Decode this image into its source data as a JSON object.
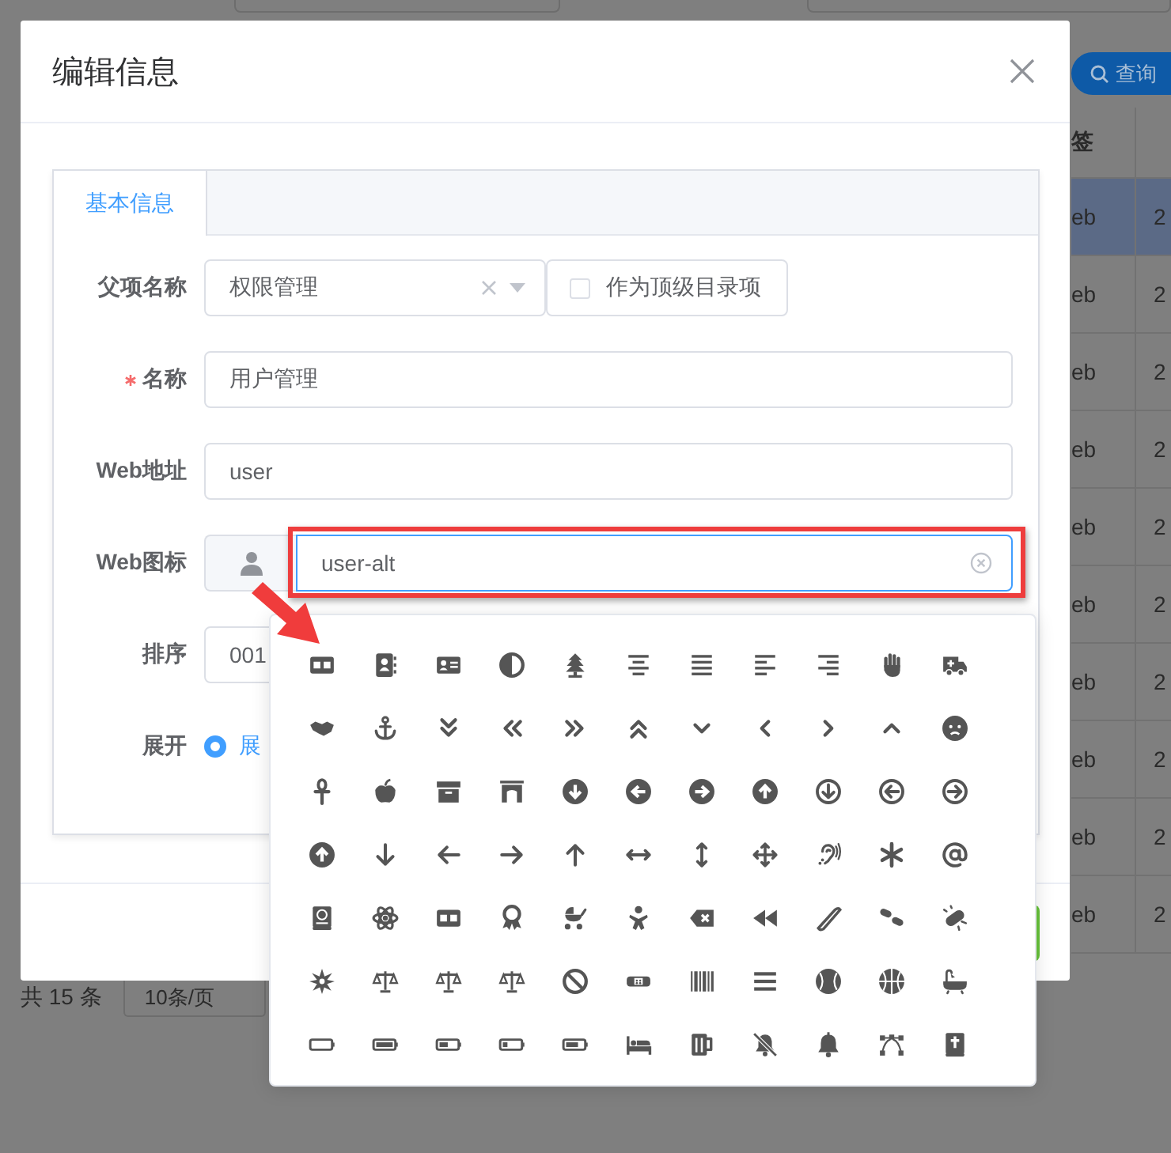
{
  "background": {
    "search_button": {
      "label": "查询"
    },
    "table": {
      "columns": [
        {
          "label": "签"
        }
      ],
      "rows": [
        {
          "cells": [
            "eb",
            "2"
          ],
          "selected": true
        },
        {
          "cells": [
            "eb",
            "2"
          ],
          "selected": false
        },
        {
          "cells": [
            "eb",
            "2"
          ],
          "selected": false
        },
        {
          "cells": [
            "eb",
            "2"
          ],
          "selected": false
        },
        {
          "cells": [
            "eb",
            "2"
          ],
          "selected": false
        },
        {
          "cells": [
            "eb",
            "2"
          ],
          "selected": false
        },
        {
          "cells": [
            "eb",
            "2"
          ],
          "selected": false
        },
        {
          "cells": [
            "eb",
            "2"
          ],
          "selected": false
        },
        {
          "cells": [
            "eb",
            "2"
          ],
          "selected": false
        },
        {
          "cells": [
            "eb",
            "2"
          ],
          "selected": false
        }
      ]
    },
    "pagination": {
      "total": "共 15 条",
      "page_size": "10条/页"
    }
  },
  "dialog": {
    "title": "编辑信息",
    "tabs": [
      {
        "label": "基本信息",
        "selected": true
      }
    ],
    "fields": [
      {
        "kind": "select",
        "label": "父项名称",
        "required": false,
        "value": "权限管理",
        "checkbox": {
          "label": "作为顶级目录项",
          "checked": false
        }
      },
      {
        "kind": "input",
        "label": "名称",
        "required": true,
        "value": "用户管理",
        "focused": false
      },
      {
        "kind": "input",
        "label": "Web地址",
        "required": false,
        "value": "user",
        "focused": false
      },
      {
        "kind": "icon_input",
        "label": "Web图标",
        "required": false,
        "value": "user-alt",
        "focused": true
      },
      {
        "kind": "input",
        "label": "排序",
        "required": false,
        "value": "001",
        "focused": false
      },
      {
        "kind": "radio",
        "label": "展开",
        "required": false,
        "options": [
          {
            "label": "展",
            "selected": true
          }
        ]
      }
    ]
  }
}
